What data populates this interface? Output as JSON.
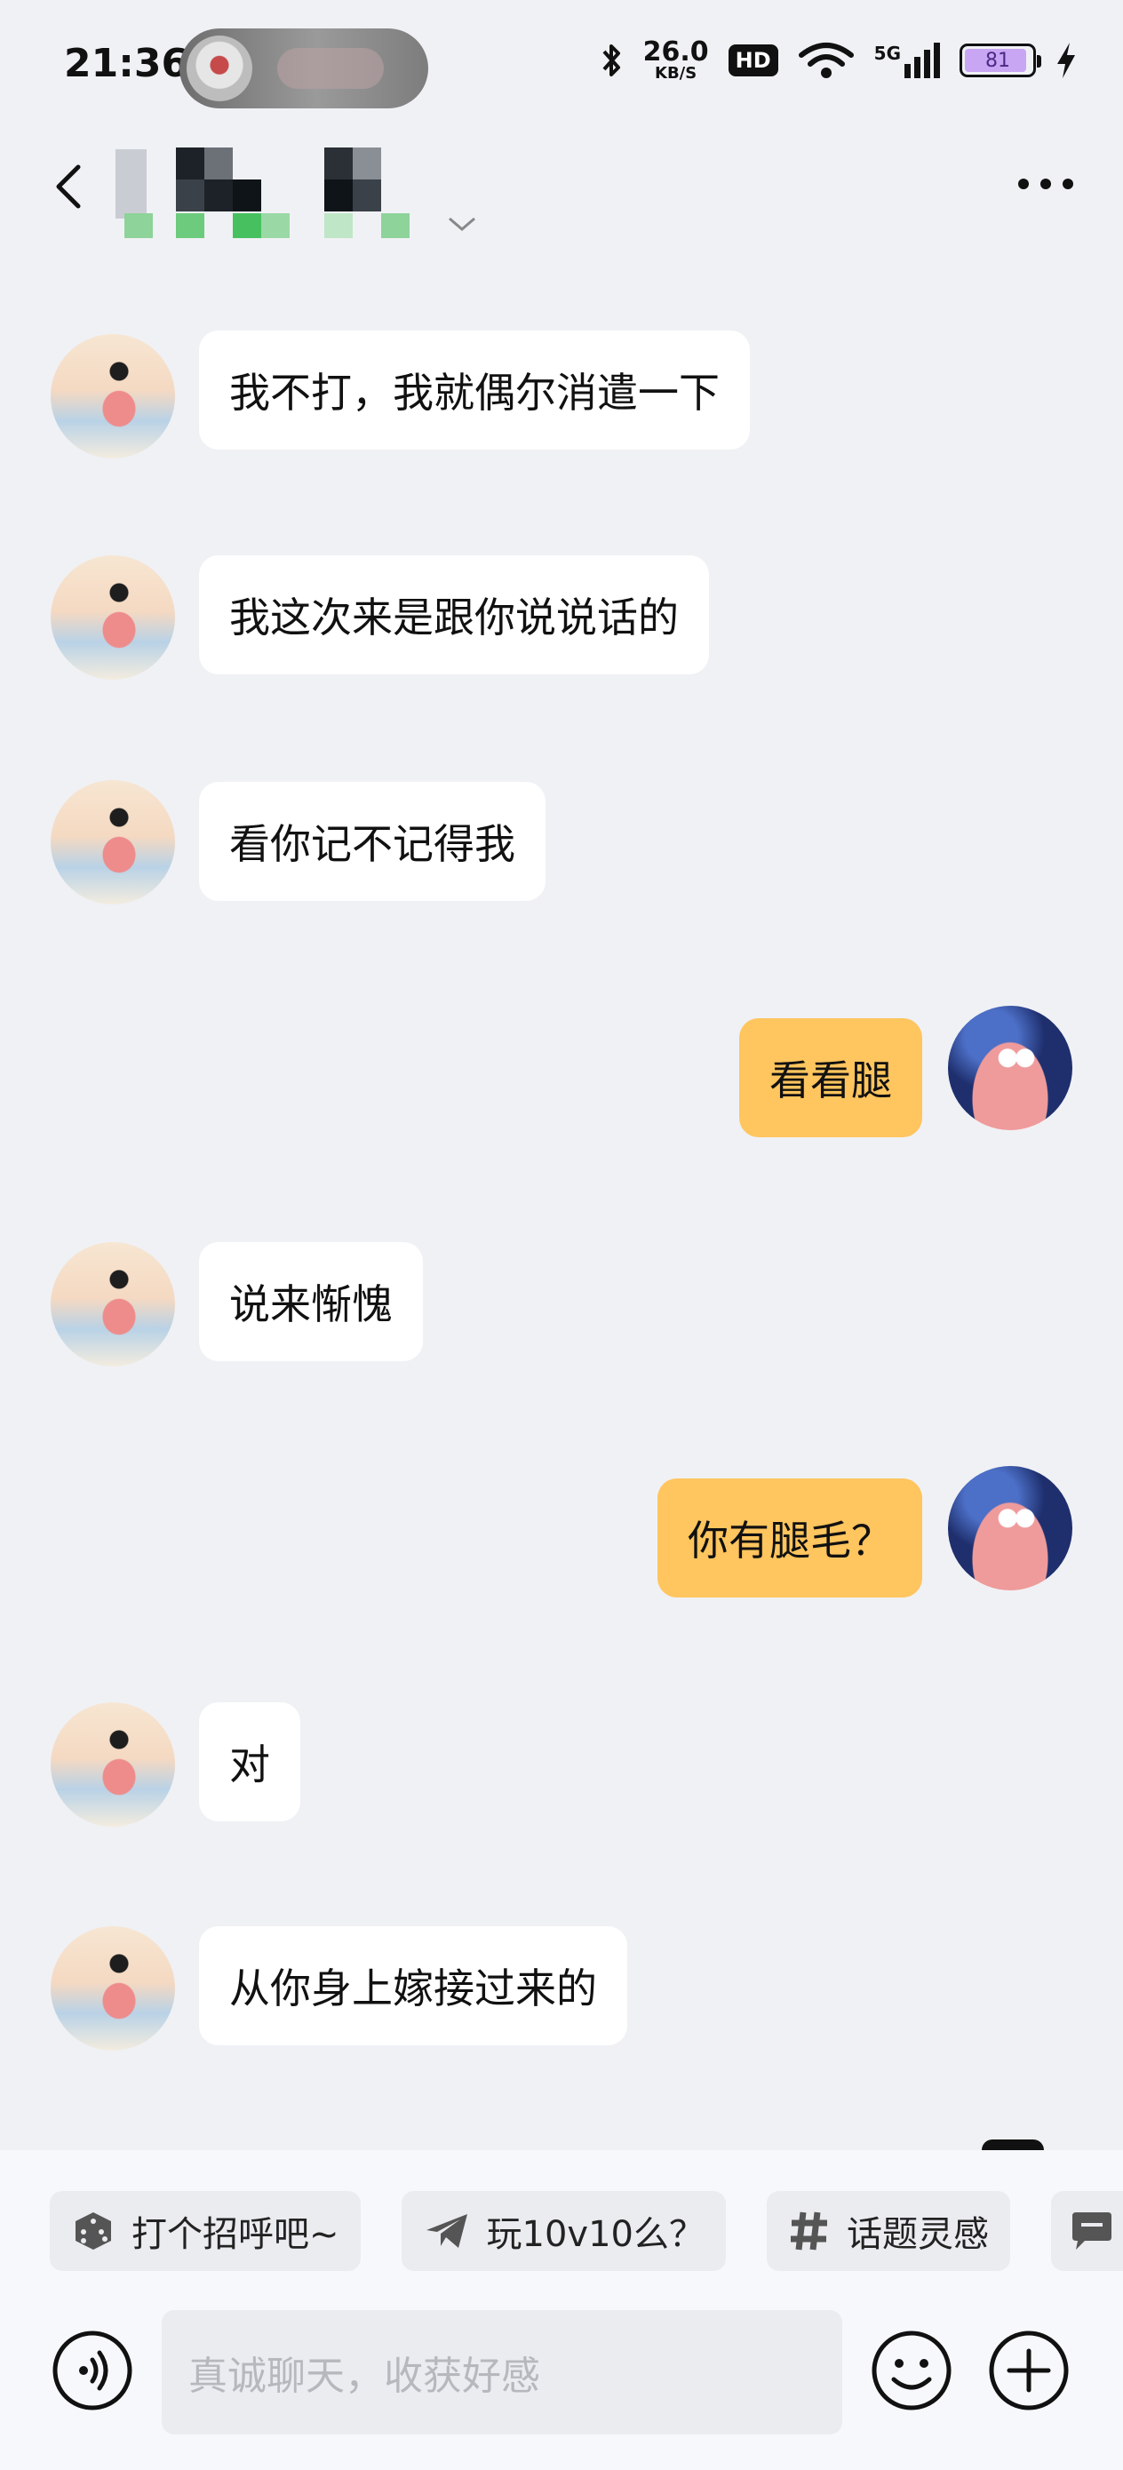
{
  "status_bar": {
    "time": "21:36",
    "network_speed": "26.0",
    "network_speed_unit": "KB/S",
    "hd_badge": "HD",
    "signal_label": "5G",
    "battery_level": "81"
  },
  "header": {
    "back_icon": "chevron-left-icon",
    "more_icon": "more-horizontal-icon"
  },
  "messages": [
    {
      "side": "left",
      "text": "我不打，我就偶尔消遣一下"
    },
    {
      "side": "left",
      "text": "我这次来是跟你说说话的"
    },
    {
      "side": "left",
      "text": "看你记不记得我"
    },
    {
      "side": "right",
      "text": "看看腿"
    },
    {
      "side": "left",
      "text": "说来惭愧"
    },
    {
      "side": "right",
      "text": "你有腿毛？"
    },
    {
      "side": "left",
      "text": "对"
    },
    {
      "side": "left",
      "text": "从你身上嫁接过来的"
    }
  ],
  "quick_replies": [
    {
      "icon": "dice-icon",
      "label": "打个招呼吧~"
    },
    {
      "icon": "paper-plane-icon",
      "label": "玩10v10么？"
    },
    {
      "icon": "hashtag-icon",
      "label": "话题灵感"
    }
  ],
  "composer": {
    "placeholder": "真诚聊天，收获好感",
    "voice_icon": "voice-icon",
    "emoji_icon": "emoji-icon",
    "plus_icon": "plus-icon"
  },
  "colors": {
    "background": "#f0f1f5",
    "outgoing_bubble": "#ffc55e",
    "incoming_bubble": "#ffffff",
    "battery_fill": "#c8a6f4"
  }
}
